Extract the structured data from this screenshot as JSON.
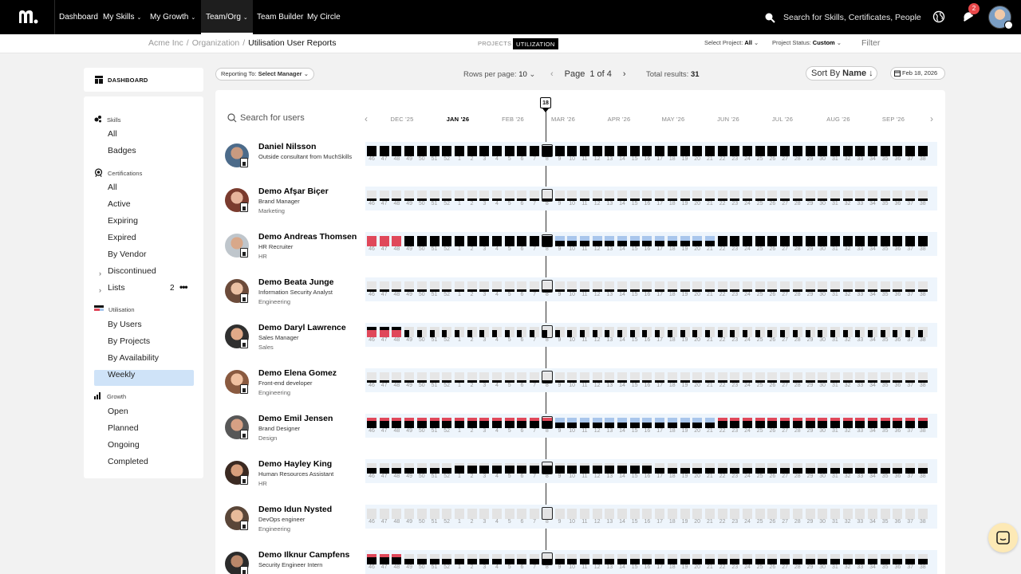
{
  "topbar": {
    "nav": [
      {
        "label": "Dashboard",
        "chevron": false
      },
      {
        "label": "My Skills",
        "chevron": true
      },
      {
        "label": "My Growth",
        "chevron": true
      },
      {
        "label": "Team/Org",
        "chevron": true,
        "active": true
      },
      {
        "label": "Team Builder",
        "chevron": false
      },
      {
        "label": "My Circle",
        "chevron": false
      }
    ],
    "search_placeholder": "Search for Skills, Certificates, People",
    "notification_count": "2"
  },
  "subbar": {
    "breadcrumb": [
      "Acme Inc",
      "Organization",
      "Utilisation User Reports"
    ],
    "view_toggle": [
      "PROJECTS",
      "UTILIZATION"
    ],
    "select_project_label": "Select Project:",
    "select_project_value": "All",
    "project_status_label": "Project Status:",
    "project_status_value": "Custom",
    "filter_label": "Filter"
  },
  "sidebar": {
    "dashboard_label": "DASHBOARD",
    "sections": [
      {
        "title": "Skills",
        "icon": "skills-icon",
        "items": [
          "All",
          "Badges"
        ]
      },
      {
        "title": "Certifications",
        "icon": "certificate-icon",
        "items": [
          "All",
          "Active",
          "Expiring",
          "Expired",
          "By Vendor",
          "Discontinued",
          "Lists"
        ]
      },
      {
        "title": "Utilisation",
        "icon": "utilisation-icon",
        "items": [
          "By Users",
          "By Projects",
          "By Availability",
          "Weekly"
        ]
      },
      {
        "title": "Growth",
        "icon": "growth-icon",
        "items": [
          "Open",
          "Planned",
          "Ongoing",
          "Completed"
        ]
      }
    ],
    "lists_count": "2",
    "active_item": "Weekly"
  },
  "controls": {
    "reporting_to_label": "Reporting To:",
    "reporting_to_value": "Select Manager",
    "rows_per_page_label": "Rows per page:",
    "rows_per_page_value": "10",
    "page_word": "Page",
    "page_of": "1 of 4",
    "total_label": "Total results:",
    "total_value": "31",
    "sort_label": "Sort By",
    "sort_value": "Name",
    "date": "Feb 18, 2026"
  },
  "timeline": {
    "search_placeholder": "Search for users",
    "months": [
      "DEC '25",
      "JAN '26",
      "FEB '26",
      "MAR '26",
      "APR '26",
      "MAY '26",
      "JUN '26",
      "JUL '26",
      "AUG '26",
      "SEP '26"
    ],
    "current_month": "JAN '26",
    "today_marker": "18",
    "weeks": [
      "46",
      "47",
      "48",
      "49",
      "50",
      "51",
      "52",
      "1",
      "2",
      "3",
      "4",
      "5",
      "6",
      "7",
      "8",
      "9",
      "10",
      "11",
      "12",
      "13",
      "14",
      "15",
      "16",
      "17",
      "18",
      "19",
      "20",
      "21",
      "22",
      "23",
      "24",
      "25",
      "26",
      "27",
      "28",
      "29",
      "30",
      "31",
      "32",
      "33",
      "34",
      "35",
      "36",
      "37",
      "38"
    ],
    "current_week": "8"
  },
  "users": [
    {
      "name": "Daniel Nilsson",
      "role": "Outside consultant from MuchSkills",
      "dept": "",
      "pattern": "full"
    },
    {
      "name": "Demo Afşar Biçer",
      "role": "Brand Manager",
      "dept": "Marketing",
      "pattern": "low"
    },
    {
      "name": "Demo Andreas Thomsen",
      "role": "HR Recruiter",
      "dept": "HR",
      "pattern": "andreas"
    },
    {
      "name": "Demo Beata Junge",
      "role": "Information Security Analyst",
      "dept": "Engineering",
      "pattern": "low"
    },
    {
      "name": "Demo Daryl Lawrence",
      "role": "Sales Manager",
      "dept": "Sales",
      "pattern": "daryl"
    },
    {
      "name": "Demo Elena Gomez",
      "role": "Front-end developer",
      "dept": "Engineering",
      "pattern": "elena"
    },
    {
      "name": "Demo Emil Jensen",
      "role": "Brand Designer",
      "dept": "Design",
      "pattern": "emil"
    },
    {
      "name": "Demo Hayley King",
      "role": "Human Resources Assistant",
      "dept": "HR",
      "pattern": "hayley"
    },
    {
      "name": "Demo Idun Nysted",
      "role": "DevOps engineer",
      "dept": "Engineering",
      "pattern": "empty"
    },
    {
      "name": "Demo Ilknur Campfens",
      "role": "Security Engineer Intern",
      "dept": "",
      "pattern": "ilknur"
    }
  ],
  "colors": {
    "booked": "#000000",
    "overbooked": "#e0485a",
    "tentative": "#a9c6ec",
    "empty": "#e3e3e3",
    "active_menu": "#cfe3f8",
    "chat": "#fde9b5"
  }
}
